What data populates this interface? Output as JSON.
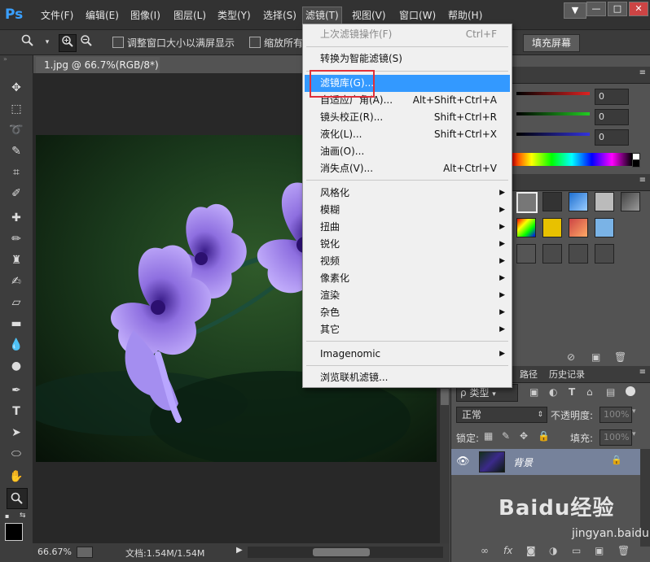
{
  "menubar": {
    "logo": "Ps",
    "items": [
      "文件(F)",
      "编辑(E)",
      "图像(I)",
      "图层(L)",
      "类型(Y)",
      "选择(S)",
      "滤镜(T)",
      "视图(V)",
      "窗口(W)",
      "帮助(H)"
    ],
    "window_controls": [
      "▼",
      "—",
      "□",
      "✕"
    ]
  },
  "options": {
    "fit_window_label": "调整窗口大小以满屏显示",
    "zoom_all_label": "缩放所有",
    "fill_screen_button": "填充屏幕"
  },
  "document": {
    "tab_title": "1.jpg @ 66.7%(RGB/8*)",
    "zoom": "66.67%",
    "doc_info": "文档:1.54M/1.54M"
  },
  "filter_menu": {
    "items": [
      {
        "label": "上次滤镜操作(F)",
        "shortcut": "Ctrl+F",
        "disabled": true
      },
      {
        "sep": true
      },
      {
        "label": "转换为智能滤镜(S)"
      },
      {
        "sep": true
      },
      {
        "label": "滤镜库(G)...",
        "highlighted": true
      },
      {
        "label": "自适应广角(A)...",
        "shortcut": "Alt+Shift+Ctrl+A"
      },
      {
        "label": "镜头校正(R)...",
        "shortcut": "Shift+Ctrl+R"
      },
      {
        "label": "液化(L)...",
        "shortcut": "Shift+Ctrl+X"
      },
      {
        "label": "油画(O)..."
      },
      {
        "label": "消失点(V)...",
        "shortcut": "Alt+Ctrl+V"
      },
      {
        "sep": true
      },
      {
        "label": "风格化",
        "submenu": true
      },
      {
        "label": "模糊",
        "submenu": true
      },
      {
        "label": "扭曲",
        "submenu": true
      },
      {
        "label": "锐化",
        "submenu": true
      },
      {
        "label": "视频",
        "submenu": true
      },
      {
        "label": "像素化",
        "submenu": true
      },
      {
        "label": "渲染",
        "submenu": true
      },
      {
        "label": "杂色",
        "submenu": true
      },
      {
        "label": "其它",
        "submenu": true
      },
      {
        "sep": true
      },
      {
        "label": "Imagenomic",
        "submenu": true
      },
      {
        "sep": true
      },
      {
        "label": "浏览联机滤镜..."
      }
    ]
  },
  "color_panel": {
    "values": [
      "0",
      "0",
      "0"
    ]
  },
  "layers_panel": {
    "tabs": [
      "路径",
      "历史记录"
    ],
    "filter_kind": "类型",
    "blend_mode": "正常",
    "opacity_label": "不透明度:",
    "opacity_value": "100%",
    "lock_label": "锁定:",
    "fill_label": "填充:",
    "fill_value": "100%",
    "layer_name": "背景"
  },
  "watermark": {
    "brand": "Baidu经验",
    "url": "jingyan.baidu.com"
  },
  "colors": {
    "menu_highlight": "#3399ff",
    "red_outline": "#e0303a"
  }
}
